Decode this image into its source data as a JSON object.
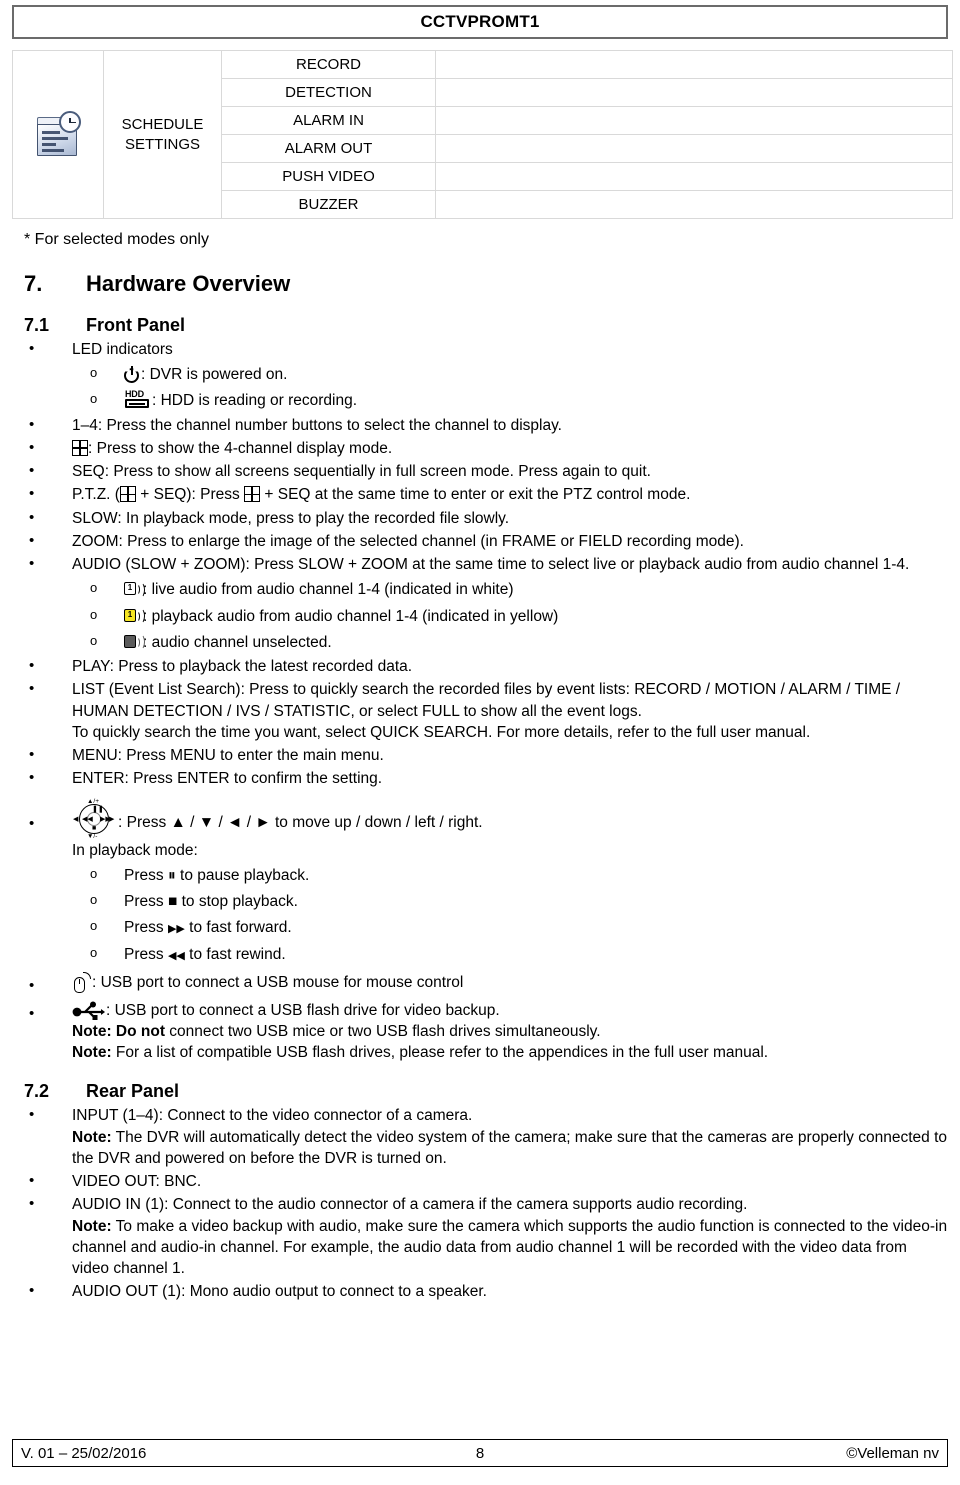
{
  "header": {
    "title": "CCTVPROMT1"
  },
  "schedule_table": {
    "icon_name": "schedule-settings-icon",
    "group_label_line1": "SCHEDULE",
    "group_label_line2": "SETTINGS",
    "items": [
      "RECORD",
      "DETECTION",
      "ALARM IN",
      "ALARM OUT",
      "PUSH VIDEO",
      "BUZZER"
    ]
  },
  "footnote": "* For selected modes only",
  "sections": {
    "hardware_overview": {
      "number": "7.",
      "title": "Hardware Overview"
    },
    "front_panel": {
      "number": "7.1",
      "title": "Front Panel"
    },
    "rear_panel": {
      "number": "7.2",
      "title": "Rear Panel"
    }
  },
  "front_panel": {
    "led_indicators_label": "LED indicators",
    "power_text": ": DVR is powered on.",
    "hdd_label": "HDD",
    "hdd_text": ": HDD is reading or recording.",
    "channel_buttons": "1–4: Press the channel number buttons to select the channel to display.",
    "quad_text": ": Press to show the 4-channel display mode.",
    "seq": "SEQ: Press to show all screens sequentially in full screen mode. Press again to quit.",
    "ptz_part1": "P.T.Z. (",
    "ptz_part2": " + SEQ): Press ",
    "ptz_part3": " + SEQ at the same time to enter or exit the PTZ control mode.",
    "slow": "SLOW: In playback mode, press to play the recorded file slowly.",
    "zoom": "ZOOM: Press to enlarge the image of the selected channel (in FRAME or FIELD recording mode).",
    "audio": "AUDIO (SLOW + ZOOM): Press SLOW + ZOOM at the same time to select live or playback audio from audio channel 1-4.",
    "audio_white": ": live audio from audio channel 1-4 (indicated in white)",
    "audio_yellow": ": playback audio from audio channel 1-4 (indicated in yellow)",
    "audio_gray": ": audio channel unselected.",
    "speaker_digit": "1",
    "play": "PLAY: Press to playback the latest recorded data.",
    "list": "LIST (Event List Search): Press to quickly search the recorded files by event lists: RECORD / MOTION / ALARM / TIME / HUMAN DETECTION / IVS / STATISTIC, or select FULL to show all the event logs.",
    "list_line2": "To quickly search the time you want, select QUICK SEARCH. For more details, refer to the full user manual.",
    "menu": "MENU: Press MENU to enter the main menu.",
    "enter": "ENTER: Press ENTER to confirm the setting.",
    "nav_text": ": Press ▲ / ▼ / ◄ / ► to move up / down / left / right.",
    "playback_mode_label": "In playback mode:",
    "pause": "Press ▐▌ to pause playback.",
    "pause_pre": "Press ",
    "pause_glyph": "⏸",
    "pause_post": " to pause playback.",
    "stop_pre": "Press ",
    "stop_glyph": "■",
    "stop_post": " to stop playback.",
    "ff_pre": "Press ",
    "ff_glyph": "▶▶",
    "ff_post": " to fast forward.",
    "rew_pre": "Press ",
    "rew_glyph": "◀◀",
    "rew_post": " to fast rewind.",
    "usb_mouse": ": USB port to connect a USB mouse for mouse control",
    "usb_flash": ": USB port to connect a USB flash drive for video backup.",
    "note1_bold": "Note: Do not",
    "note1_rest": " connect two USB mice or two USB flash drives simultaneously.",
    "note2_bold": "Note:",
    "note2_rest": " For a list of compatible USB flash drives, please refer to the appendices in the full user manual."
  },
  "rear_panel": {
    "input": "INPUT (1–4): Connect to the video connector of a camera.",
    "input_note_bold": "Note:",
    "input_note_rest": " The DVR will automatically detect the video system of the camera; make sure that the cameras are properly connected to the DVR and powered on before the DVR is turned on.",
    "video_out": "VIDEO OUT: BNC.",
    "audio_in": "AUDIO IN (1): Connect to the audio connector of a camera if the camera supports audio recording.",
    "audio_in_note_bold": "Note:",
    "audio_in_note_rest": " To make a video backup with audio, make sure the camera which supports the audio function is connected to the video-in channel and audio-in channel. For example, the audio data from audio channel 1 will be recorded with the video data from video channel 1.",
    "audio_out": "AUDIO OUT (1): Mono audio output to connect to a speaker."
  },
  "footer": {
    "version": "V. 01 – 25/02/2016",
    "page": "8",
    "copyright": "©Velleman nv"
  },
  "bullets": {
    "disc": "•",
    "circle": "o"
  }
}
